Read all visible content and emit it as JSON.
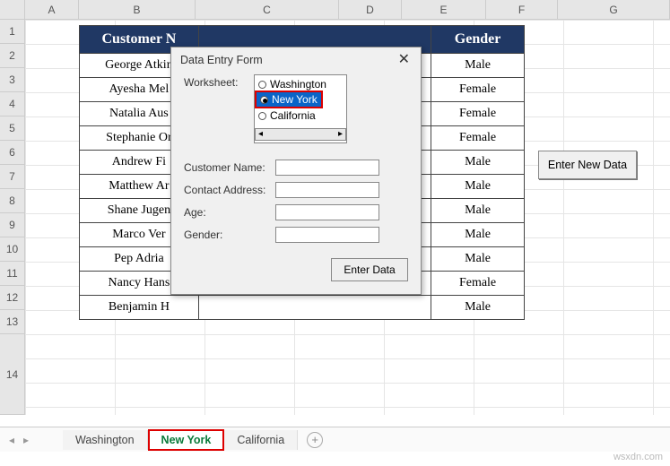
{
  "columns": [
    {
      "label": "A",
      "w": 60
    },
    {
      "label": "B",
      "w": 130
    },
    {
      "label": "C",
      "w": 160
    },
    {
      "label": "D",
      "w": 70
    },
    {
      "label": "E",
      "w": 94
    },
    {
      "label": "F",
      "w": 80
    },
    {
      "label": "G",
      "w": 125
    }
  ],
  "rows": [
    "1",
    "2",
    "3",
    "4",
    "5",
    "6",
    "7",
    "8",
    "9",
    "10",
    "11",
    "12",
    "13",
    "14"
  ],
  "table": {
    "headers": [
      "Customer N",
      "Gender"
    ],
    "data": [
      {
        "name": "George Atkin",
        "gender": "Male"
      },
      {
        "name": "Ayesha Mel",
        "gender": "Female"
      },
      {
        "name": "Natalia Aus",
        "gender": "Female"
      },
      {
        "name": "Stephanie Or",
        "gender": "Female"
      },
      {
        "name": "Andrew Fi",
        "gender": "Male"
      },
      {
        "name": "Matthew Ar",
        "gender": "Male"
      },
      {
        "name": "Shane Jugen",
        "gender": "Male"
      },
      {
        "name": "Marco Ver",
        "gender": "Male"
      },
      {
        "name": "Pep Adria",
        "gender": "Male"
      },
      {
        "name": "Nancy Hans",
        "gender": "Female"
      },
      {
        "name": "Benjamin H",
        "gender": "Male"
      }
    ]
  },
  "side_button": "Enter New Data",
  "dialog": {
    "title": "Data Entry Form",
    "worksheet_label": "Worksheet:",
    "options": [
      "Washington",
      "New York",
      "California"
    ],
    "selected_index": 1,
    "fields": {
      "customer": {
        "label": "Customer Name:",
        "value": ""
      },
      "address": {
        "label": "Contact Address:",
        "value": ""
      },
      "age": {
        "label": "Age:",
        "value": ""
      },
      "gender": {
        "label": "Gender:",
        "value": ""
      }
    },
    "submit": "Enter Data"
  },
  "tabs": {
    "items": [
      "Washington",
      "New York",
      "California"
    ],
    "active_index": 1
  },
  "watermark": "wsxdn.com"
}
